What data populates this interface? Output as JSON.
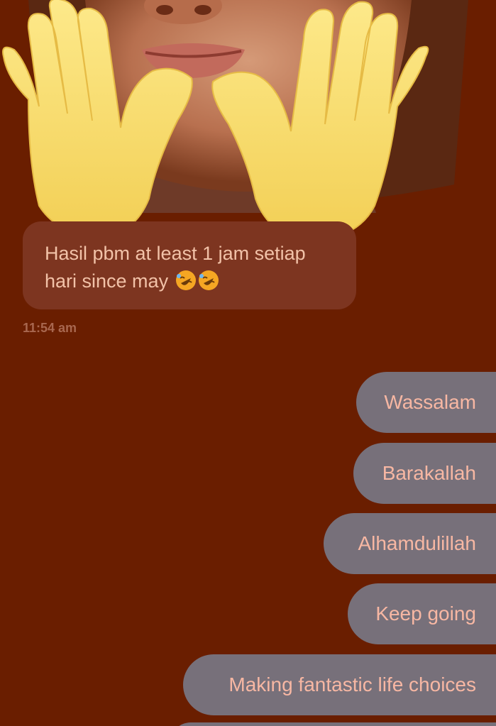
{
  "conversation": {
    "incoming": {
      "text": "Hasil pbm at least 1 jam setiap hari since may",
      "emoji": [
        "rolling-on-floor-laughing-emoji",
        "rolling-on-floor-laughing-emoji"
      ],
      "timestamp": "11:54 am"
    },
    "outgoing": [
      {
        "text": "Wassalam"
      },
      {
        "text": "Barakallah"
      },
      {
        "text": "Alhamdulillah"
      },
      {
        "text": "Keep going"
      },
      {
        "text": "Making fantastic life choices"
      }
    ]
  },
  "colors": {
    "background": "#6a1e00",
    "incoming_bubble": "#7d3520",
    "incoming_text": "#f2c2a8",
    "outgoing_bubble": "#77707a",
    "outgoing_text": "#f7b7a3",
    "timestamp": "#a8674f"
  }
}
